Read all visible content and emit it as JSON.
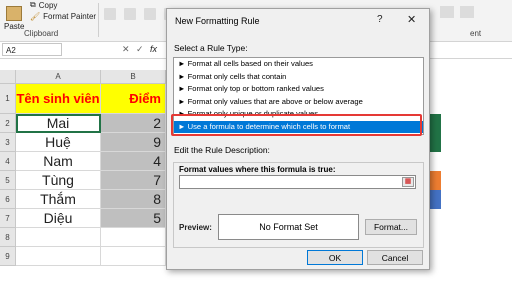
{
  "ribbon": {
    "paste_label": "Paste",
    "copy_label": "Copy",
    "format_painter_label": "Format Painter",
    "clipboard_group": "Clipboard",
    "alignment_fragment": "ent"
  },
  "formula_bar": {
    "name_box": "A2",
    "fx_label": "fx",
    "cancel_symbol": "✕",
    "enter_symbol": "✓"
  },
  "columns": [
    "A",
    "B"
  ],
  "rows": [
    "1",
    "2",
    "3",
    "4",
    "5",
    "6",
    "7",
    "8",
    "9"
  ],
  "table": {
    "header_name": "Tên sinh viên",
    "header_score": "Điểm",
    "records": [
      {
        "name": "Mai",
        "score": "2"
      },
      {
        "name": "Huệ",
        "score": "9"
      },
      {
        "name": "Nam",
        "score": "4"
      },
      {
        "name": "Tùng",
        "score": "7"
      },
      {
        "name": "Thắm",
        "score": "8"
      },
      {
        "name": "Diệu",
        "score": "5"
      }
    ]
  },
  "colors": {
    "header_fill": "#ffff00",
    "header_text": "#ff0000",
    "score_fill": "#bfbfbf",
    "selection": "#0078d7",
    "highlight_box": "#e53935",
    "side_bars": [
      "#217346",
      "#217346",
      "#ed7d31",
      "#4472c4"
    ]
  },
  "dialog": {
    "title": "New Formatting Rule",
    "help": "?",
    "close": "✕",
    "select_rule_type_label": "Select a Rule Type:",
    "rule_types": [
      "► Format all cells based on their values",
      "► Format only cells that contain",
      "► Format only top or bottom ranked values",
      "► Format only values that are above or below average",
      "► Format only unique or duplicate values",
      "► Use a formula to determine which cells to format"
    ],
    "selected_rule_index": 5,
    "edit_description_label": "Edit the Rule Description:",
    "formula_label": "Format values where this formula is true:",
    "formula_value": "",
    "preview_label": "Preview:",
    "preview_text": "No Format Set",
    "format_button": "Format...",
    "ok_button": "OK",
    "cancel_button": "Cancel"
  }
}
